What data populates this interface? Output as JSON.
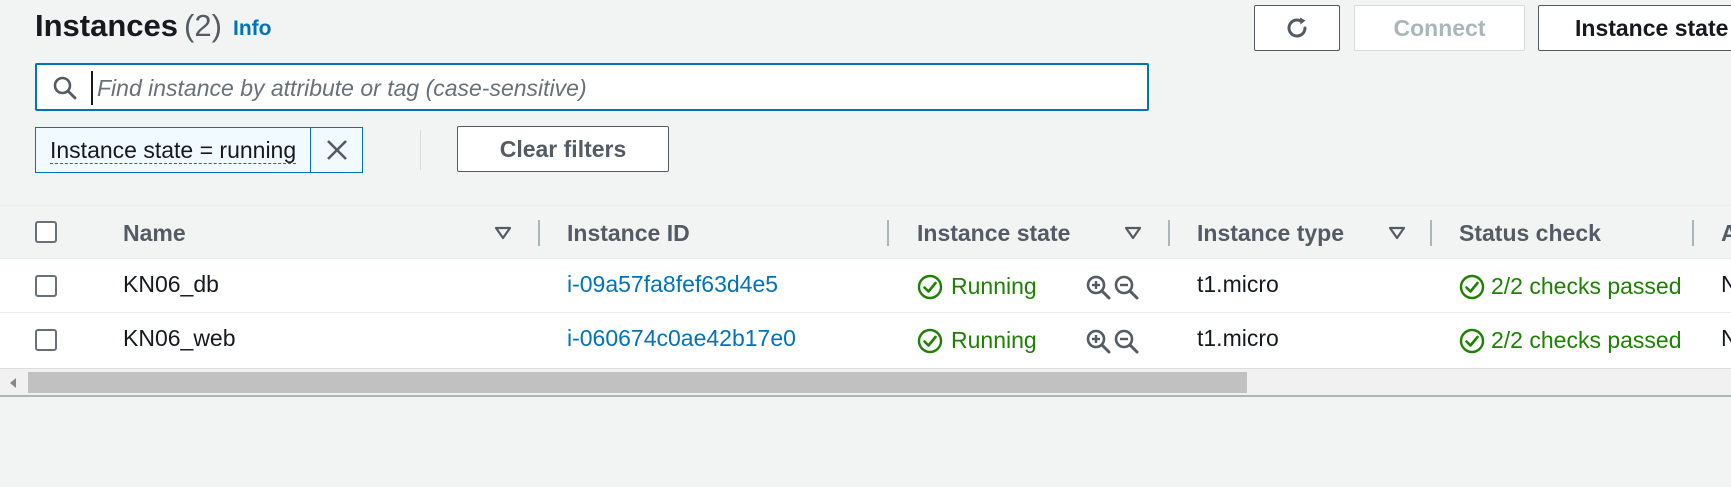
{
  "header": {
    "title": "Instances",
    "count": "(2)",
    "info_link": "Info"
  },
  "toolbar": {
    "refresh_icon": "refresh-icon",
    "connect_label": "Connect",
    "instance_state_label": "Instance state"
  },
  "search": {
    "placeholder": "Find instance by attribute or tag (case-sensitive)",
    "value": ""
  },
  "filters": {
    "token_label": "Instance state = running",
    "clear_label": "Clear filters"
  },
  "table": {
    "columns": [
      "Name",
      "Instance ID",
      "Instance state",
      "Instance type",
      "Status check",
      "A"
    ],
    "rows": [
      {
        "name": "KN06_db",
        "instance_id": "i-09a57fa8fef63d4e5",
        "state": "Running",
        "type": "t1.micro",
        "status_check": "2/2 checks passed",
        "next_col": "N"
      },
      {
        "name": "KN06_web",
        "instance_id": "i-060674c0ae42b17e0",
        "state": "Running",
        "type": "t1.micro",
        "status_check": "2/2 checks passed",
        "next_col": "N"
      }
    ]
  },
  "colors": {
    "link": "#0073bb",
    "success": "#1d8102",
    "border": "#545b64"
  }
}
